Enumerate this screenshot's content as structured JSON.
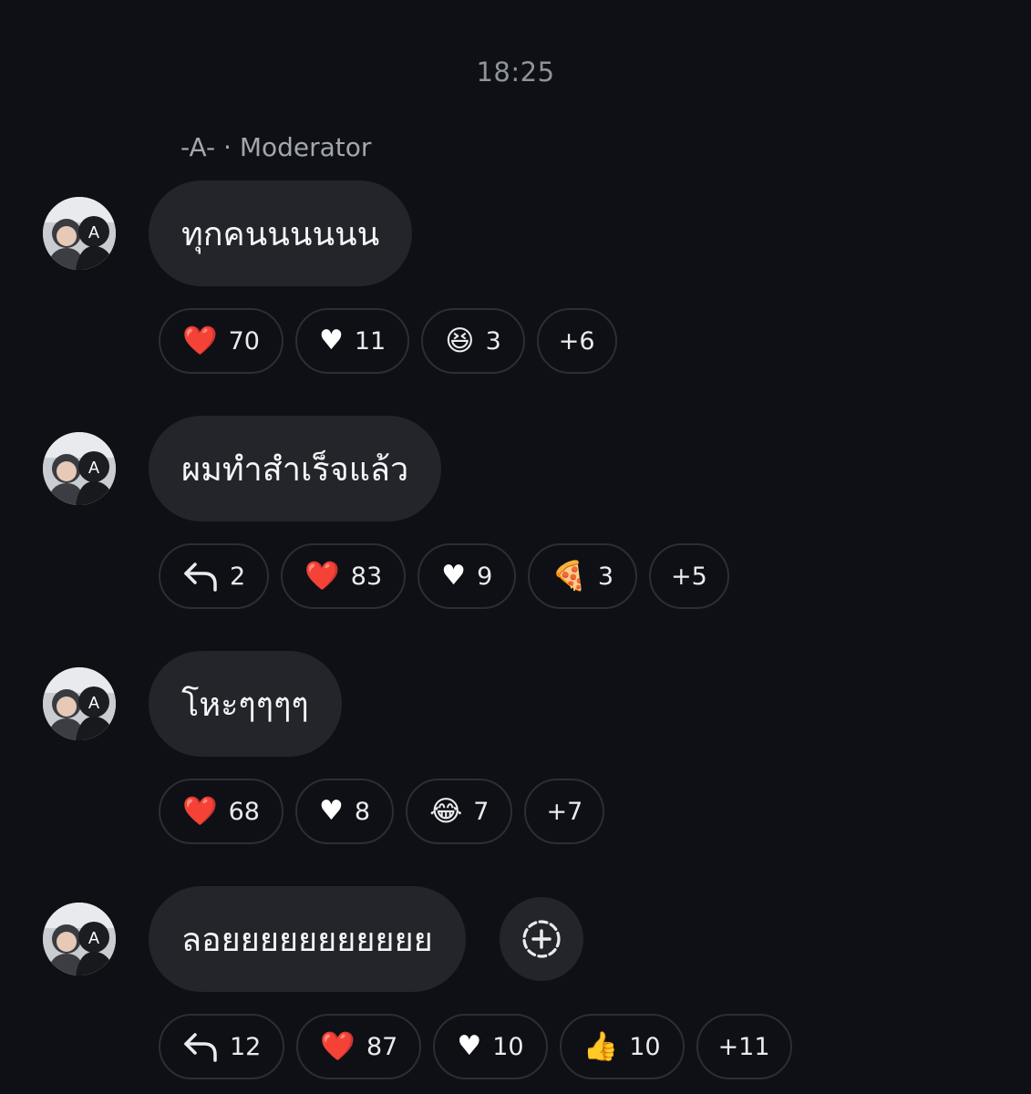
{
  "timestamp": "18:25",
  "sender": "-A- · Moderator",
  "messages": [
    {
      "text": "ทุกคนนนนนน",
      "reactions": [
        {
          "icon": "red-heart",
          "glyph": "❤️",
          "count": "70"
        },
        {
          "icon": "white-heart",
          "glyph": "♥",
          "count": "11"
        },
        {
          "icon": "laughing-face",
          "glyph": "😆",
          "count": "3"
        }
      ],
      "more": "+6"
    },
    {
      "text": "ผมทำสำเร็จแล้ว",
      "reply_count": "2",
      "reactions": [
        {
          "icon": "red-heart",
          "glyph": "❤️",
          "count": "83"
        },
        {
          "icon": "white-heart",
          "glyph": "♥",
          "count": "9"
        },
        {
          "icon": "pizza",
          "glyph": "🍕",
          "count": "3"
        }
      ],
      "more": "+5"
    },
    {
      "text": "โหะๆๆๆๆ",
      "reactions": [
        {
          "icon": "red-heart",
          "glyph": "❤️",
          "count": "68"
        },
        {
          "icon": "white-heart",
          "glyph": "♥",
          "count": "8"
        },
        {
          "icon": "tears-of-joy-face",
          "glyph": "😂",
          "count": "7"
        }
      ],
      "more": "+7"
    },
    {
      "text": "ลอยยยยยยยยยยย",
      "reply_count": "12",
      "reactions": [
        {
          "icon": "red-heart",
          "glyph": "❤️",
          "count": "87"
        },
        {
          "icon": "white-heart",
          "glyph": "♥",
          "count": "10"
        },
        {
          "icon": "thumbs-up",
          "glyph": "👍",
          "count": "10"
        }
      ],
      "more": "+11"
    }
  ],
  "colors": {
    "background": "#0e1015",
    "bubble": "#23252b",
    "chip_border": "#2b2e35",
    "heart_red": "#e4202f"
  }
}
